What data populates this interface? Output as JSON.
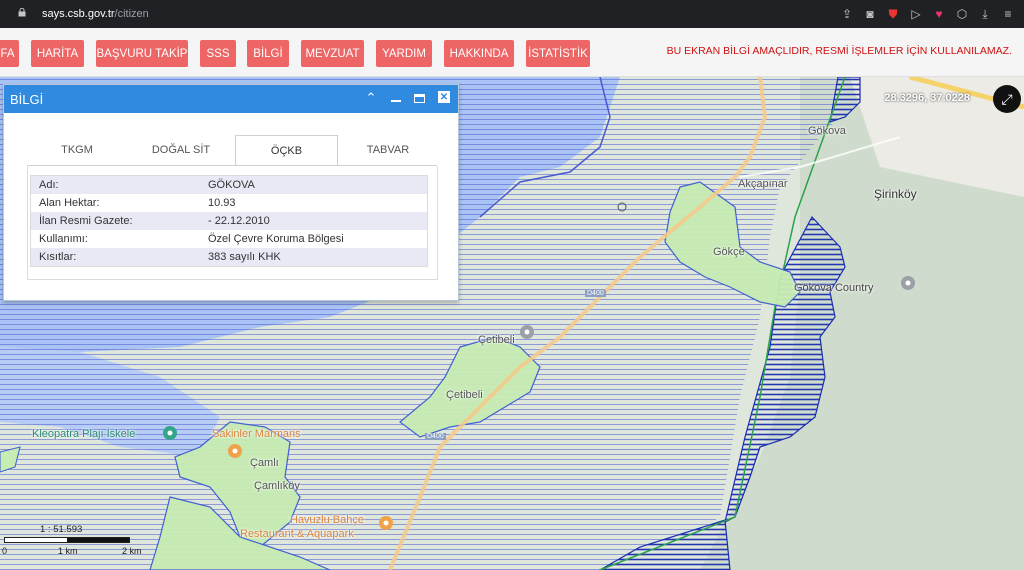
{
  "browser": {
    "url_host": "says.csb.gov.tr",
    "url_path": "/citizen"
  },
  "nav": {
    "items": [
      {
        "label": "FA"
      },
      {
        "label": "HARİTA"
      },
      {
        "label": "BAŞVURU TAKİP"
      },
      {
        "label": "SSS"
      },
      {
        "label": "BİLGİ"
      },
      {
        "label": "MEVZUAT"
      },
      {
        "label": "YARDIM"
      },
      {
        "label": "HAKKINDA"
      },
      {
        "label": "İSTATİSTİK"
      }
    ],
    "notice": "BU EKRAN BİLGİ AMAÇLIDIR, RESMİ İŞLEMLER İÇİN KULLANILAMAZ."
  },
  "map": {
    "coords": "28.3296, 37.0228",
    "labels": {
      "gokova_top": "Gökova",
      "akcapinar": "Akçapınar",
      "sirinkoy": "Şirinköy",
      "gokce": "Gökçe",
      "country": "Gökova Country",
      "cetibeli_a": "Çetibeli",
      "cetibeli_b": "Çetibeli",
      "kleopatra": "Kleopatra Plajı İskele",
      "sakinlar": "Sakinler Marmaris",
      "camli": "Çamlı",
      "camlikoy": "Çamlıköy",
      "havuzlu_a": "Havuzlu Bahçe",
      "havuzlu_b": "Restaurant & Aquapark",
      "road_a": "D400",
      "road_b": "D400"
    },
    "scale": {
      "ratio": "1 : 51.593",
      "t0": "0",
      "t1": "1 km",
      "t2": "2 km"
    }
  },
  "panel": {
    "title": "BİLGİ",
    "tabs": [
      "TKGM",
      "DOĞAL SİT",
      "ÖÇKB",
      "TABVAR"
    ],
    "active_tab": "ÖÇKB",
    "rows": [
      {
        "key": "Adı:",
        "value": "GÖKOVA"
      },
      {
        "key": "Alan Hektar:",
        "value": "10.93"
      },
      {
        "key": "İlan Resmi Gazete:",
        "value": "- 22.12.2010"
      },
      {
        "key": "Kullanımı:",
        "value": "Özel Çevre Koruma Bölgesi"
      },
      {
        "key": "Kısıtlar:",
        "value": "383 sayılı KHK"
      }
    ]
  },
  "colors": {
    "accent": "#2f8ae0",
    "nav_button": "#ee6565",
    "notice": "#d01010",
    "hatch": "#3546c8"
  }
}
